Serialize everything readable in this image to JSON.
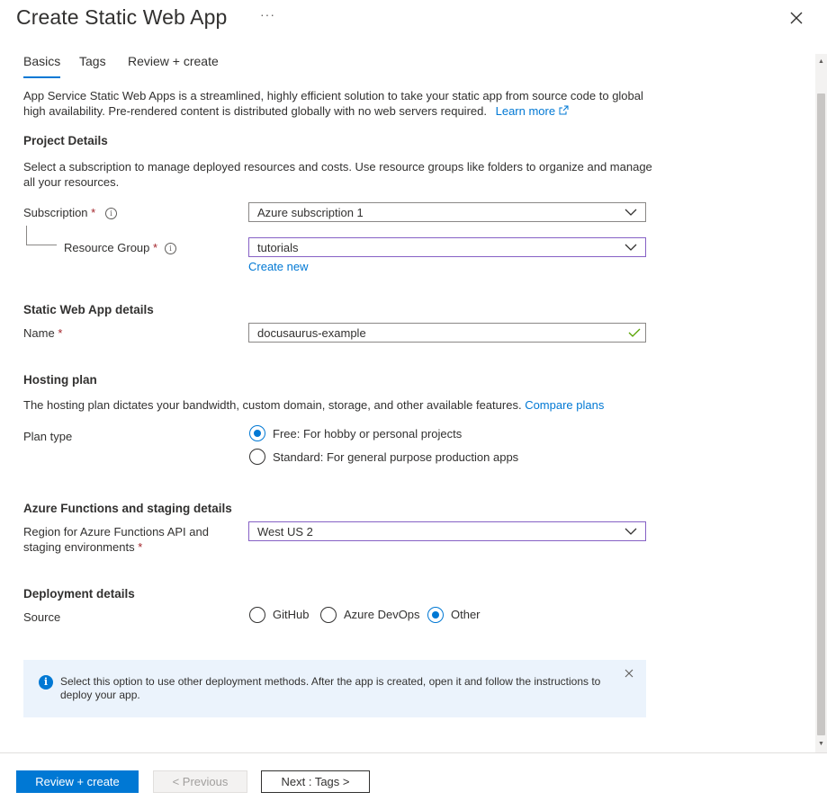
{
  "header": {
    "title": "Create Static Web App",
    "more_label": "···"
  },
  "tabs": [
    {
      "label": "Basics",
      "active": true
    },
    {
      "label": "Tags",
      "active": false
    },
    {
      "label": "Review + create",
      "active": false
    }
  ],
  "intro": {
    "text": "App Service Static Web Apps is a streamlined, highly efficient solution to take your static app from source code to global high availability. Pre-rendered content is distributed globally with no web servers required.",
    "learn_more": "Learn more"
  },
  "project_details": {
    "heading": "Project Details",
    "description": "Select a subscription to manage deployed resources and costs. Use resource groups like folders to organize and manage all your resources.",
    "subscription": {
      "label": "Subscription",
      "required_mark": "*",
      "value": "Azure subscription 1"
    },
    "resource_group": {
      "label": "Resource Group",
      "required_mark": "*",
      "value": "tutorials",
      "create_new": "Create new"
    }
  },
  "app_details": {
    "heading": "Static Web App details",
    "name": {
      "label": "Name",
      "required_mark": "*",
      "value": "docusaurus-example"
    }
  },
  "hosting": {
    "heading": "Hosting plan",
    "description": "The hosting plan dictates your bandwidth, custom domain, storage, and other available features.",
    "compare_link": "Compare plans",
    "plan_label": "Plan type",
    "options": [
      {
        "label": "Free: For hobby or personal projects",
        "selected": true
      },
      {
        "label": "Standard: For general purpose production apps",
        "selected": false
      }
    ]
  },
  "functions": {
    "heading": "Azure Functions and staging details",
    "region_label_line1": "Region for Azure Functions API and",
    "region_label_line2": "staging environments",
    "required_mark": "*",
    "region_value": "West US 2"
  },
  "deployment": {
    "heading": "Deployment details",
    "source_label": "Source",
    "options": [
      {
        "label": "GitHub",
        "selected": false
      },
      {
        "label": "Azure DevOps",
        "selected": false
      },
      {
        "label": "Other",
        "selected": true
      }
    ]
  },
  "banner": {
    "icon": "info-icon",
    "text": "Select this option to use other deployment methods. After the app is created, open it and follow the instructions to deploy your app."
  },
  "footer": {
    "review_create": "Review + create",
    "previous": "< Previous",
    "next": "Next : Tags >"
  },
  "colors": {
    "accent": "#0078d4",
    "required": "#a4262c",
    "selected_border": "#8661c5",
    "banner_bg": "#ebf3fc",
    "valid_check": "#57a300"
  }
}
